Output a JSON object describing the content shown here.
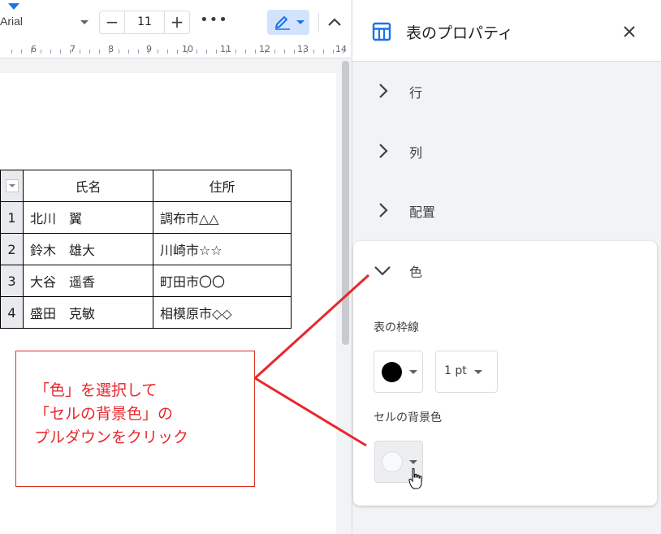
{
  "toolbar": {
    "font_name": "Arial",
    "font_size": "11",
    "minus": "−",
    "plus": "+",
    "more": "•••"
  },
  "ruler": {
    "numbers": [
      "6",
      "7",
      "8",
      "9",
      "10",
      "11",
      "12",
      "13",
      "14"
    ]
  },
  "table": {
    "headers": [
      "氏名",
      "住所"
    ],
    "rows": [
      {
        "n": "1",
        "name": "北川　翼",
        "addr": "調布市△△"
      },
      {
        "n": "2",
        "name": "鈴木　雄大",
        "addr": "川崎市☆☆"
      },
      {
        "n": "3",
        "name": "大谷　遥香",
        "addr": "町田市〇〇"
      },
      {
        "n": "4",
        "name": "盛田　克敏",
        "addr": "相模原市◇◇"
      }
    ]
  },
  "annotation": {
    "text": "「色」を選択して\n「セルの背景色」の\nプルダウンをクリック",
    "color": "#e8272c"
  },
  "panel": {
    "title": "表のプロパティ",
    "sections": {
      "row": "行",
      "column": "列",
      "alignment": "配置",
      "color": "色"
    },
    "table_border_label": "表の枠線",
    "border_color": "#000000",
    "border_width": "1 pt",
    "cell_bg_label": "セルの背景色"
  },
  "colors": {
    "accent": "#1a73e8",
    "edit_bg": "#d3e3fd"
  }
}
